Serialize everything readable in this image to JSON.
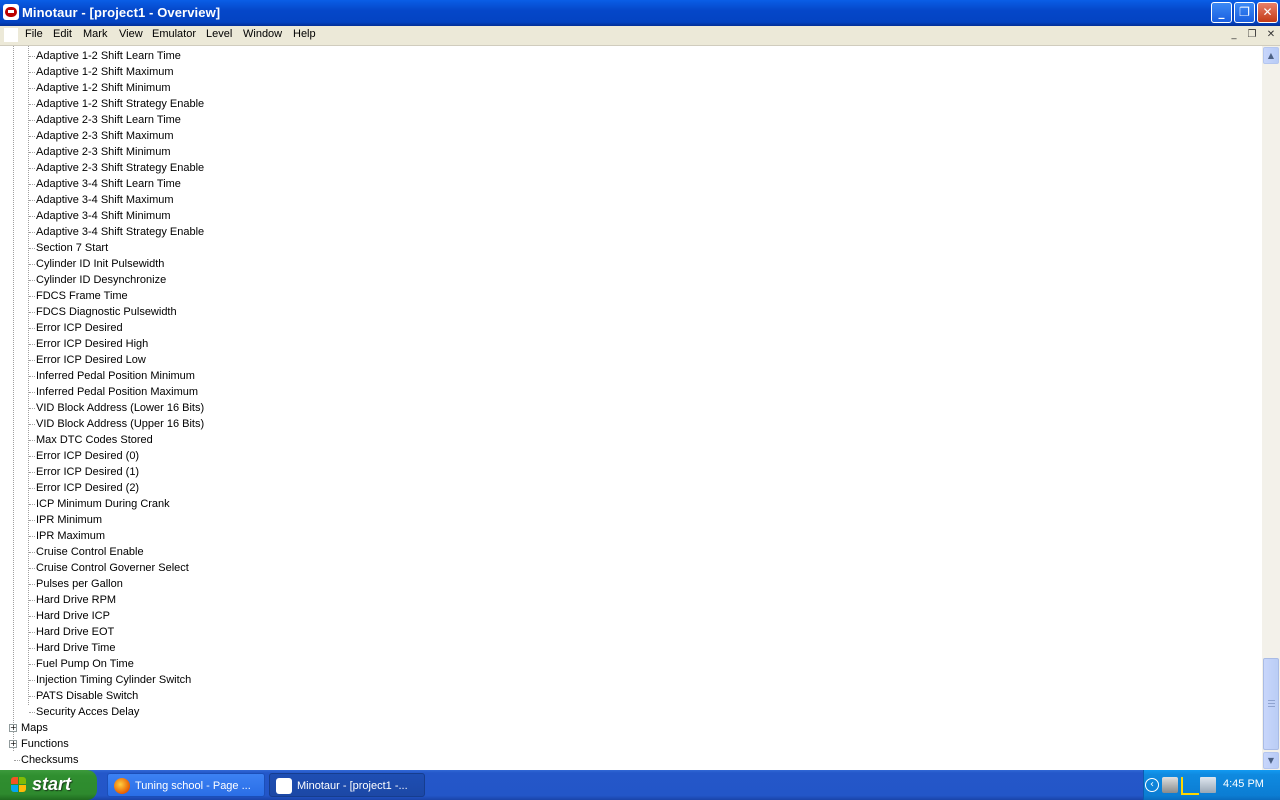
{
  "window": {
    "title": "Minotaur - [project1 - Overview]",
    "controls": {
      "minimize": "_",
      "restore": "❐",
      "close": "✕"
    }
  },
  "menubar": {
    "items": [
      "File",
      "Edit",
      "Mark",
      "View",
      "Emulator",
      "Level",
      "Window",
      "Help"
    ],
    "mdi_controls": {
      "minimize": "_",
      "restore": "❐",
      "close": "✕"
    }
  },
  "tree": {
    "children": [
      "Adaptive 1-2 Shift Learn Time",
      "Adaptive 1-2 Shift Maximum",
      "Adaptive 1-2 Shift Minimum",
      "Adaptive 1-2 Shift Strategy Enable",
      "Adaptive 2-3 Shift Learn Time",
      "Adaptive 2-3 Shift Maximum",
      "Adaptive 2-3 Shift Minimum",
      "Adaptive 2-3 Shift Strategy Enable",
      "Adaptive 3-4 Shift Learn Time",
      "Adaptive 3-4 Shift Maximum",
      "Adaptive 3-4 Shift Minimum",
      "Adaptive 3-4 Shift Strategy Enable",
      "Section 7 Start",
      "Cylinder ID Init Pulsewidth",
      "Cylinder ID Desynchronize",
      "FDCS Frame Time",
      "FDCS Diagnostic Pulsewidth",
      "Error ICP Desired",
      "Error ICP Desired High",
      "Error ICP Desired Low",
      "Inferred Pedal Position Minimum",
      "Inferred Pedal Position Maximum",
      "VID Block Address (Lower 16 Bits)",
      "VID Block Address (Upper 16 Bits)",
      "Max DTC Codes Stored",
      "Error ICP Desired (0)",
      "Error ICP Desired (1)",
      "Error ICP Desired (2)",
      "ICP Minimum During Crank",
      "IPR Minimum",
      "IPR Maximum",
      "Cruise Control Enable",
      "Cruise Control Governer Select",
      "Pulses per Gallon",
      "Hard Drive RPM",
      "Hard Drive ICP",
      "Hard Drive EOT",
      "Hard Drive Time",
      "Fuel Pump On Time",
      "Injection Timing Cylinder Switch",
      "PATS Disable Switch",
      "Security Acces Delay"
    ],
    "top_level": [
      {
        "label": "Maps",
        "expander": "+"
      },
      {
        "label": "Functions",
        "expander": "+"
      },
      {
        "label": "Checksums",
        "expander": ""
      }
    ]
  },
  "scrollbar": {
    "up_arrow": "▲",
    "down_arrow": "▼",
    "position": 0.95
  },
  "taskbar": {
    "start_label": "start",
    "tasks": [
      {
        "label": "Tuning school - Page ...",
        "active": false
      },
      {
        "label": "Minotaur - [project1 -...",
        "active": true
      }
    ],
    "tray": {
      "clock": "4:45 PM",
      "chevron": "‹"
    }
  },
  "colors": {
    "titlebar": "#0547c9",
    "menubar": "#ece9d8",
    "start_button": "#2f8e2f",
    "taskbar": "#2457c9",
    "tray": "#0f8ae0"
  }
}
